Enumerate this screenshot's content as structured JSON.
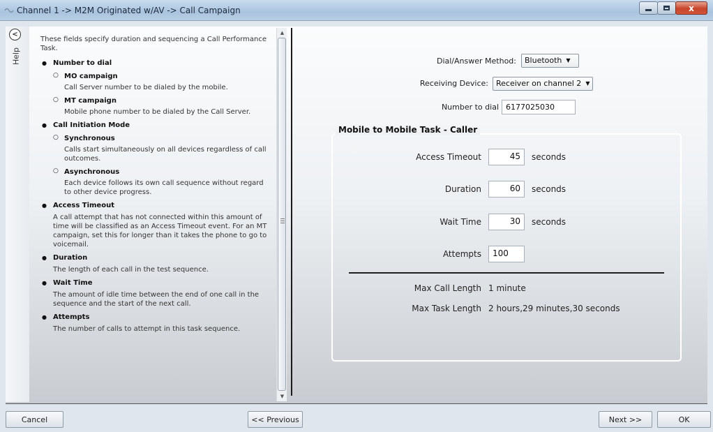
{
  "window": {
    "title": "Channel 1 -> M2M Originated w/AV -> Call Campaign",
    "close_glyph": "x"
  },
  "help": {
    "tab_label": "Help",
    "collapse_glyph": "<",
    "intro": "These fields specify duration and sequencing a Call Performance Task.",
    "number_to_dial": {
      "heading": "Number to dial",
      "mo_heading": "MO campaign",
      "mo_text": "Call Server number to be dialed by the mobile.",
      "mt_heading": "MT campaign",
      "mt_text": "Mobile phone number to be dialed by the Call Server."
    },
    "call_initiation": {
      "heading": "Call Initiation Mode",
      "sync_heading": "Synchronous",
      "sync_text": "Calls start simultaneously on all devices regardless of call outcomes.",
      "async_heading": "Asynchronous",
      "async_text": "Each device follows its own call sequence without regard to other device progress."
    },
    "access_timeout": {
      "heading": "Access Timeout",
      "text": "A call attempt that has not connected within this amount of time will be classified as an Access Timeout event.  For an MT campaign, set this for longer than it takes the phone to go to voicemail."
    },
    "duration": {
      "heading": "Duration",
      "text": "The length of each call in the test sequence."
    },
    "wait_time": {
      "heading": "Wait Time",
      "text": "The amount of idle time between the end of one call in the sequence and the start of the next call."
    },
    "attempts": {
      "heading": "Attempts",
      "text": "The number of calls to attempt in this task sequence."
    }
  },
  "form": {
    "dial_method_label": "Dial/Answer Method:",
    "dial_method_value": "Bluetooth",
    "receiving_device_label": "Receiving Device:",
    "receiving_device_value": "Receiver on channel 2",
    "number_label": "Number to dial",
    "number_value": "6177025030"
  },
  "task": {
    "title": "Mobile to Mobile Task - Caller",
    "access_timeout_label": "Access Timeout",
    "access_timeout_value": "45",
    "duration_label": "Duration",
    "duration_value": "60",
    "wait_time_label": "Wait Time",
    "wait_time_value": "30",
    "attempts_label": "Attempts",
    "attempts_value": "100",
    "unit_seconds": "seconds",
    "max_call_label": "Max Call Length",
    "max_call_value": "1 minute",
    "max_task_label": "Max Task Length",
    "max_task_value": "2 hours,29 minutes,30 seconds"
  },
  "buttons": {
    "cancel": "Cancel",
    "previous": "<< Previous",
    "next": "Next >>",
    "ok": "OK"
  },
  "icons": {
    "app": "window-app-icon",
    "caret": "chevron-down-icon",
    "scroll_up": "scroll-up-icon",
    "scroll_down": "scroll-down-icon"
  }
}
